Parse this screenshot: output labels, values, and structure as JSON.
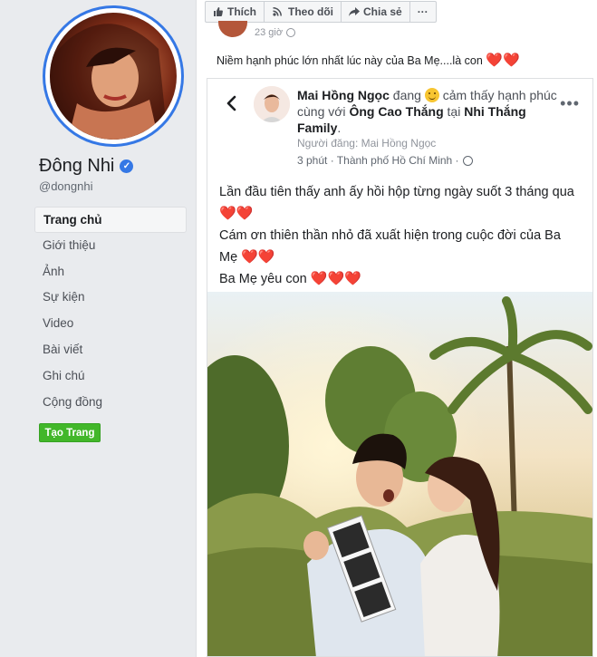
{
  "sidebar": {
    "page_name": "Đông Nhi",
    "handle": "@dongnhi",
    "nav": [
      "Trang chủ",
      "Giới thiệu",
      "Ảnh",
      "Sự kiện",
      "Video",
      "Bài viết",
      "Ghi chú",
      "Cộng đồng"
    ],
    "active_index": 0,
    "create_page_label": "Tạo Trang"
  },
  "actions": {
    "like": "Thích",
    "follow": "Theo dõi",
    "share": "Chia sẻ",
    "more": "···"
  },
  "post": {
    "time": "23 giờ",
    "caption": "Niềm hạnh phúc lớn nhất lúc này của Ba Mẹ....là con",
    "caption_hearts": "❤️❤️"
  },
  "shared": {
    "author": "Mai Hồng Ngọc",
    "verb": "đang",
    "feeling": "cảm thấy hạnh phúc",
    "with_label": "cùng với",
    "tagged": "Ông Cao Thắng",
    "at_label": "tại",
    "place": "Nhi Thắng Family",
    "poster": "Người đăng: Mai Hồng Ngọc",
    "time": "3 phút · Thành phố Hồ Chí Minh ·",
    "line1": "Lần đầu tiên thấy anh ấy hồi hộp từng ngày suốt 3 tháng qua",
    "line1_hearts": "❤️❤️",
    "line2": "Cám ơn thiên thần nhỏ đã xuất hiện trong cuộc đời của Ba Mẹ",
    "line2_hearts": "❤️❤️",
    "line3": "Ba Mẹ yêu con",
    "line3_hearts": "❤️❤️❤️"
  },
  "colors": {
    "facebook_blue": "#3578e5",
    "green_button": "#42b72a",
    "heart": "#e23d23"
  }
}
